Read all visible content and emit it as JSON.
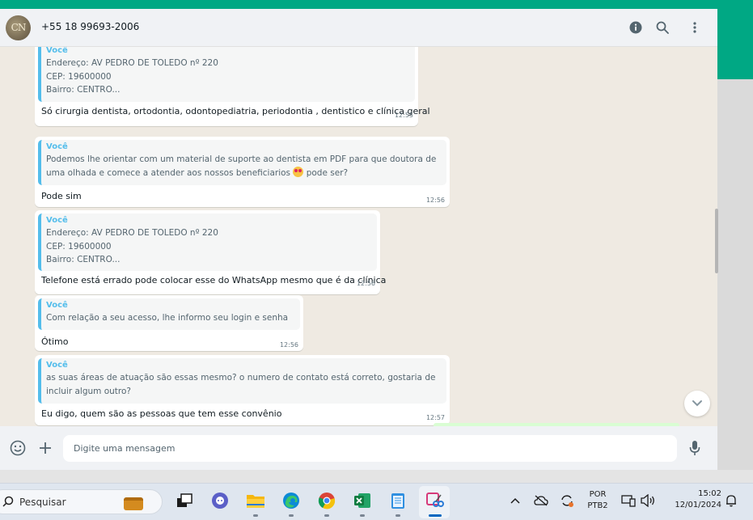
{
  "header": {
    "avatar_initials": "CN",
    "contact_name": "+55 18 99693-2006",
    "icons": [
      "info-icon",
      "search-icon",
      "menu-kebab-icon"
    ]
  },
  "messages": [
    {
      "quote_author": "Você",
      "quote_lines": [
        "Endereço: AV PEDRO DE TOLEDO nº 220",
        "CEP: 19600000",
        "Bairro: CENTRO..."
      ],
      "text": "Só cirurgia dentista, ortodontia, odontopediatria, periodontia , dentistico e clínica geral",
      "time": "12:55"
    },
    {
      "quote_author": "Você",
      "quote_lines": [
        "Podemos lhe orientar com um material de suporte ao dentista em PDF para que doutora de",
        "uma olhada e comece a atender aos nossos beneficiarios"
      ],
      "quote_line_suffix": "pode ser?",
      "text": "Pode sim",
      "time": "12:56"
    },
    {
      "quote_author": "Você",
      "quote_lines": [
        "Endereço: AV PEDRO DE TOLEDO nº 220",
        "CEP: 19600000",
        "Bairro: CENTRO..."
      ],
      "text": "Telefone está errado pode colocar esse do WhatsApp mesmo que é da clínica",
      "time": "12:56"
    },
    {
      "quote_author": "Você",
      "quote_lines": [
        "Com relação a seu acesso, lhe informo seu login e senha"
      ],
      "text": "Ótimo",
      "time": "12:56"
    },
    {
      "quote_author": "Você",
      "quote_lines": [
        "as suas áreas de atuação são essas mesmo? o numero de contato está correto, gostaria de",
        "incluir algum outro?"
      ],
      "text": "Eu digo, quem são as pessoas que tem esse convênio",
      "time": "12:57"
    }
  ],
  "composer": {
    "placeholder": "Digite uma mensagem",
    "value": ""
  },
  "taskbar": {
    "search_label": "Pesquisar",
    "language_line1": "POR",
    "language_line2": "PTB2",
    "clock_time": "15:02",
    "clock_date": "12/01/2024"
  },
  "colors": {
    "accent": "#00a884",
    "quote_bar": "#53bdeb",
    "chat_bg": "#efeae2"
  }
}
